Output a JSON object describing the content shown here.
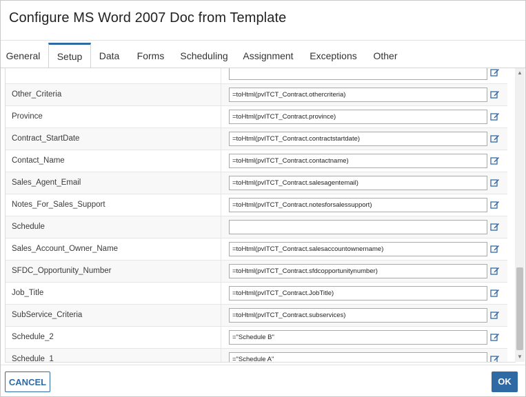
{
  "dialog": {
    "title": "Configure MS Word 2007 Doc from Template"
  },
  "tabs": [
    {
      "label": "General"
    },
    {
      "label": "Setup"
    },
    {
      "label": "Data"
    },
    {
      "label": "Forms"
    },
    {
      "label": "Scheduling"
    },
    {
      "label": "Assignment"
    },
    {
      "label": "Exceptions"
    },
    {
      "label": "Other"
    }
  ],
  "active_tab": "Setup",
  "rows": [
    {
      "label": "",
      "value": ""
    },
    {
      "label": "Other_Criteria",
      "value": "=toHtml(pvITCT_Contract.othercriteria)"
    },
    {
      "label": "Province",
      "value": "=toHtml(pvITCT_Contract.province)"
    },
    {
      "label": "Contract_StartDate",
      "value": "=toHtml(pvITCT_Contract.contractstartdate)"
    },
    {
      "label": "Contact_Name",
      "value": "=toHtml(pvITCT_Contract.contactname)"
    },
    {
      "label": "Sales_Agent_Email",
      "value": "=toHtml(pvITCT_Contract.salesagentemail)"
    },
    {
      "label": "Notes_For_Sales_Support",
      "value": "=toHtml(pvITCT_Contract.notesforsalessupport)"
    },
    {
      "label": "Schedule",
      "value": ""
    },
    {
      "label": "Sales_Account_Owner_Name",
      "value": "=toHtml(pvITCT_Contract.salesaccountownername)"
    },
    {
      "label": "SFDC_Opportunity_Number",
      "value": "=toHtml(pvITCT_Contract.sfdcopportunitynumber)"
    },
    {
      "label": "Job_Title",
      "value": "=toHtml(pvITCT_Contract.JobTitle)"
    },
    {
      "label": "SubService_Criteria",
      "value": "=toHtml(pvITCT_Contract.subservices)"
    },
    {
      "label": "Schedule_2",
      "value": "=\"Schedule B\""
    },
    {
      "label": "Schedule_1",
      "value": "=\"Schedule A\""
    }
  ],
  "footer": {
    "cancel_label": "CANCEL",
    "ok_label": "OK"
  },
  "colors": {
    "accent": "#2f6aa5",
    "row_alt": "#f8f8f8",
    "border": "#a9a9a9"
  },
  "icons": {
    "edit": "edit-pencil-icon",
    "scroll_up": "chevron-up-icon",
    "scroll_down": "chevron-down-icon"
  }
}
